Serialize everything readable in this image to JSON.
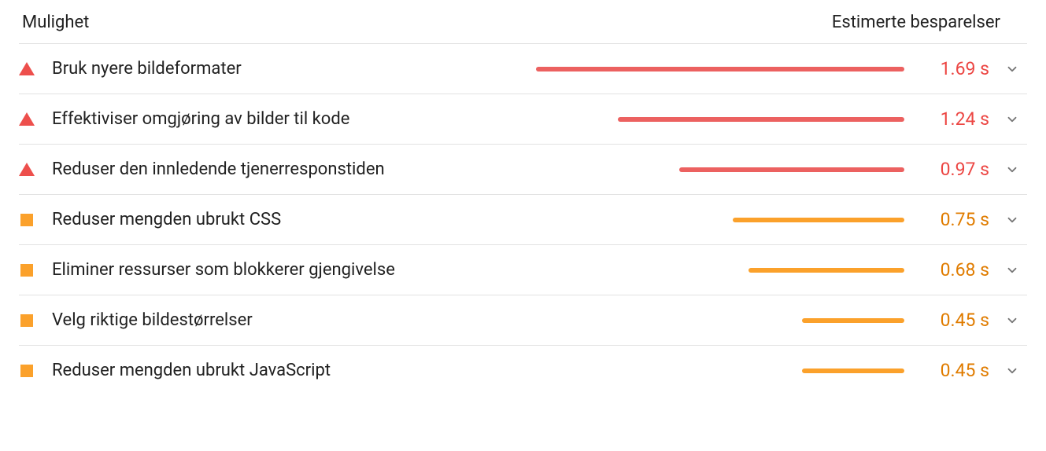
{
  "header": {
    "left": "Mulighet",
    "right": "Estimerte besparelser"
  },
  "colors": {
    "red": "#ec6160",
    "red_text": "#ec4643",
    "orange": "#fba12b",
    "orange_text": "#e07c00"
  },
  "items": [
    {
      "severity": "red",
      "label": "Bruk nyere bildeformater",
      "value": "1.69 s",
      "bar_pct": 90
    },
    {
      "severity": "red",
      "label": "Effektiviser omgjøring av bilder til kode",
      "value": "1.24 s",
      "bar_pct": 70
    },
    {
      "severity": "red",
      "label": "Reduser den innledende tjenerresponstiden",
      "value": "0.97 s",
      "bar_pct": 55
    },
    {
      "severity": "orange",
      "label": "Reduser mengden ubrukt CSS",
      "value": "0.75 s",
      "bar_pct": 42
    },
    {
      "severity": "orange",
      "label": "Eliminer ressurser som blokkerer gjengivelse",
      "value": "0.68 s",
      "bar_pct": 38
    },
    {
      "severity": "orange",
      "label": "Velg riktige bildestørrelser",
      "value": "0.45 s",
      "bar_pct": 25
    },
    {
      "severity": "orange",
      "label": "Reduser mengden ubrukt JavaScript",
      "value": "0.45 s",
      "bar_pct": 25
    }
  ]
}
